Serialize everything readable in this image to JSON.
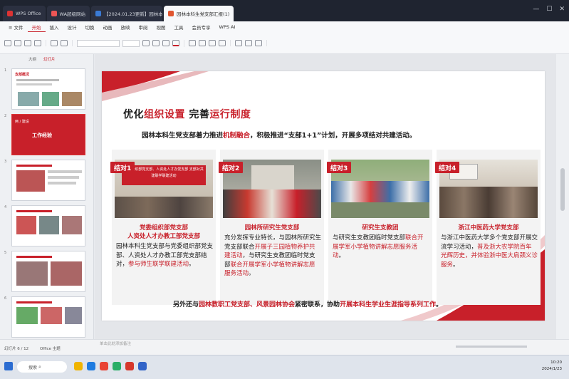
{
  "titlebar": {
    "tabs": [
      {
        "label": "WPS Office",
        "active": false
      },
      {
        "label": "WA超级网站",
        "active": false
      },
      {
        "label": "【2024.01.23更新】园林本科生党支部",
        "active": false
      },
      {
        "label": "园林本科生党支部汇报(1)",
        "active": true
      }
    ]
  },
  "menu": {
    "items": [
      "≡ 文件",
      "开始",
      "插入",
      "设计",
      "切换",
      "动画",
      "放映",
      "审阅",
      "视图",
      "工具",
      "会员专享",
      "WPS AI"
    ],
    "active_index": 1
  },
  "sidepanel": {
    "tabs": [
      "大纲",
      "幻灯片"
    ],
    "active_tab": 1,
    "slides": [
      {
        "num": "1",
        "caption": "支部概况"
      },
      {
        "num": "2",
        "caption": "工作经验"
      },
      {
        "num": "3",
        "caption": ""
      },
      {
        "num": "4",
        "caption": ""
      },
      {
        "num": "5",
        "caption": ""
      },
      {
        "num": "6",
        "caption": ""
      }
    ],
    "selected_slide": 1
  },
  "slide": {
    "title_part1": "优化",
    "title_part2": "组织设置",
    "title_part3": " 完善",
    "title_part4": "运行制度",
    "subtitle_part1": "园林本科生党支部着力推进",
    "subtitle_part2": "机制融合",
    "subtitle_part3": "，积极推进“支部1+1”计划，开展多项结对共建活动。",
    "cards": [
      {
        "label": "结对1",
        "heading_line1": "党委组织部党支部",
        "heading_line2": "人资处人才办教工部党支部",
        "body_plain": "园林本科生党支部与党委组织部党支部、人资处人才办教工部党支部结对，",
        "body_red": "参与师生联学联建活动",
        "body_end": "。",
        "banner_text": "党委组织部党支部、人资处人才办党支部 支部对共建联学联建活动"
      },
      {
        "label": "结对2",
        "heading_line1": "园林所研究生党支部",
        "heading_line2": "",
        "body_plain": "充分发挥专业特长，与园林所研究生党支部联合",
        "body_red": "开展子三园植物养护共建活动",
        "body_mid": "，与研究生支教团临时党支部",
        "body_red2": "联合开展学军小学植物讲解志愿服务活动",
        "body_end": "。"
      },
      {
        "label": "结对3",
        "heading_line1": "研究生支教团",
        "heading_line2": "",
        "body_plain": "与研究生支教团临时党支部",
        "body_red": "联合开展学军小学植物讲解志愿服务活动",
        "body_end": "。"
      },
      {
        "label": "结对4",
        "heading_line1": "浙江中医药大学党支部",
        "heading_line2": "",
        "body_plain": "与浙江中医药大学多个党支部开展交流学习活动，",
        "body_red": "普及浙大农学院百年光辉历史，并体验浙中医大肩颈义诊服务",
        "body_end": "。"
      }
    ],
    "footer_part1": "另外还与",
    "footer_part2": "园林教职工党支部、风景园林协会",
    "footer_part3": "紧密联系，协助",
    "footer_part4": "开展本科生学业生涯指导系列工作",
    "footer_part5": "。"
  },
  "notes_placeholder": "单击此处添加备注",
  "status": {
    "slide_counter": "幻灯片 6 / 12",
    "theme": "Office 主题"
  },
  "taskbar": {
    "search_label": "搜索",
    "time": "10:20",
    "date": "2024/1/23"
  },
  "colors": {
    "accent": "#c8202a",
    "dark_titlebar": "#1f2430"
  }
}
